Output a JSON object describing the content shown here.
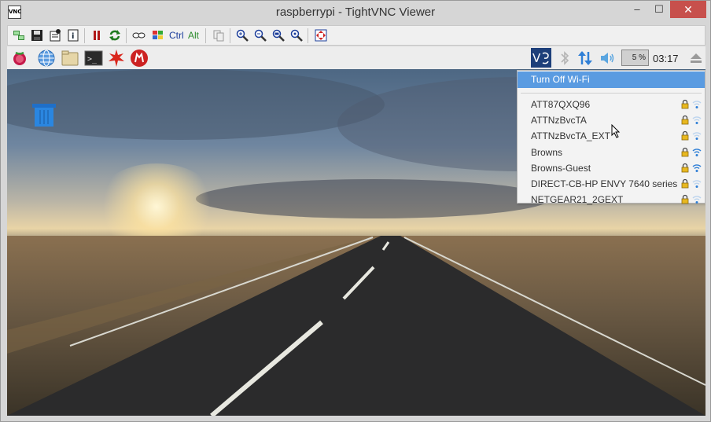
{
  "window": {
    "title": "raspberrypi - TightVNC Viewer",
    "app_icon_text": "VNC",
    "minimize": "–",
    "maximize": "☐",
    "close": "✕"
  },
  "vnc_toolbar": {
    "ctrl_label": "Ctrl",
    "alt_label": "Alt"
  },
  "panel": {
    "cpu_usage": "5 %",
    "clock": "03:17"
  },
  "wifi_menu": {
    "toggle_label": "Turn Off Wi-Fi",
    "networks": [
      {
        "ssid": "ATT87QXQ96",
        "secured": true,
        "signal": "weak"
      },
      {
        "ssid": "ATTNzBvcTA",
        "secured": true,
        "signal": "weak"
      },
      {
        "ssid": "ATTNzBvcTA_EXT",
        "secured": true,
        "signal": "weak"
      },
      {
        "ssid": "Browns",
        "secured": true,
        "signal": "strong"
      },
      {
        "ssid": "Browns-Guest",
        "secured": true,
        "signal": "strong"
      },
      {
        "ssid": "DIRECT-CB-HP ENVY 7640 series",
        "secured": true,
        "signal": "weak"
      },
      {
        "ssid": "NETGEAR21_2GEXT",
        "secured": true,
        "signal": "weak"
      }
    ]
  },
  "colors": {
    "menu_highlight": "#5a9be1",
    "close_button": "#c7504c",
    "network_icon_blue": "#2f7fd6"
  }
}
